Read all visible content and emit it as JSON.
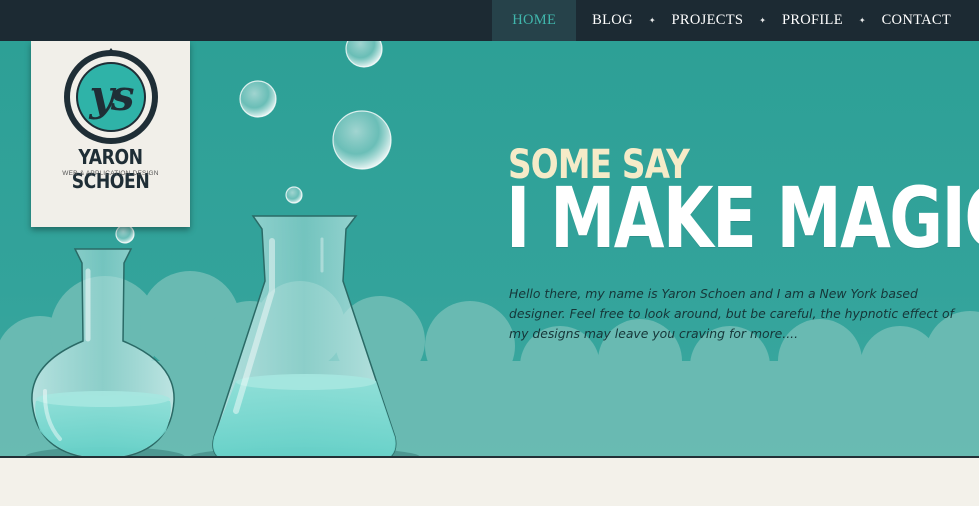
{
  "nav": {
    "items": [
      {
        "label": "HOME",
        "active": true
      },
      {
        "label": "BLOG",
        "active": false
      },
      {
        "label": "PROJECTS",
        "active": false
      },
      {
        "label": "PROFILE",
        "active": false
      },
      {
        "label": "CONTACT",
        "active": false
      }
    ],
    "separator": "✦"
  },
  "logo": {
    "monogram": "ys",
    "name": "YARON SCHOEN",
    "tagline": "WEB & APPLICATION DESIGN"
  },
  "hero": {
    "eyebrow": "SOME SAY",
    "headline": "I MAKE MAGIC",
    "intro": "Hello there, my name is Yaron Schoen and I am a New York based designer. Feel free to look around, but be careful, the hypnotic effect of my designs may leave you craving for more....",
    "illustration": [
      "round-bottom-flask",
      "erlenmeyer-flask",
      "bubbles",
      "smoke-cloud"
    ]
  },
  "colors": {
    "nav_bg": "#1c2a33",
    "nav_active_bg": "#26424a",
    "accent": "#40b6ac",
    "hero_bg": "#2f9e95",
    "floor": "#f3f1ea",
    "eyebrow": "#f5ebc8",
    "logo_dark": "#1f2e36"
  }
}
